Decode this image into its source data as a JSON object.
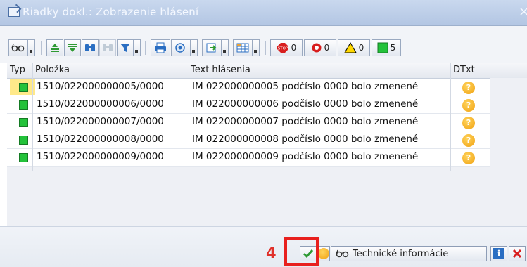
{
  "window": {
    "title": "Riadky dokl.: Zobrazenie hlásení",
    "close_icon": "close-icon"
  },
  "toolbar": {
    "counters": [
      {
        "name": "stop",
        "value": "0"
      },
      {
        "name": "error",
        "value": "0"
      },
      {
        "name": "warning",
        "value": "0"
      },
      {
        "name": "success",
        "value": "5"
      }
    ]
  },
  "table": {
    "columns": [
      "Typ",
      "Položka",
      "Text hlásenia",
      "DTxt"
    ],
    "rows": [
      {
        "item": "1510/022000000005/0000",
        "text": "IM 022000000005 podčíslo 0000 bolo zmenené"
      },
      {
        "item": "1510/022000000006/0000",
        "text": "IM 022000000006 podčíslo 0000 bolo zmenené"
      },
      {
        "item": "1510/022000000007/0000",
        "text": "IM 022000000007 podčíslo 0000 bolo zmenené"
      },
      {
        "item": "1510/022000000008/0000",
        "text": "IM 022000000008 podčíslo 0000 bolo zmenené"
      },
      {
        "item": "1510/022000000009/0000",
        "text": "IM 022000000009 podčíslo 0000 bolo zmenené"
      }
    ],
    "dtxt_icon": "?"
  },
  "footer": {
    "step_number": "4",
    "tech_info_label": "Technické informácie"
  },
  "colors": {
    "success": "#23c23a",
    "highlight": "#e8201e",
    "warning": "#ffd800",
    "error": "#d81e1e"
  }
}
